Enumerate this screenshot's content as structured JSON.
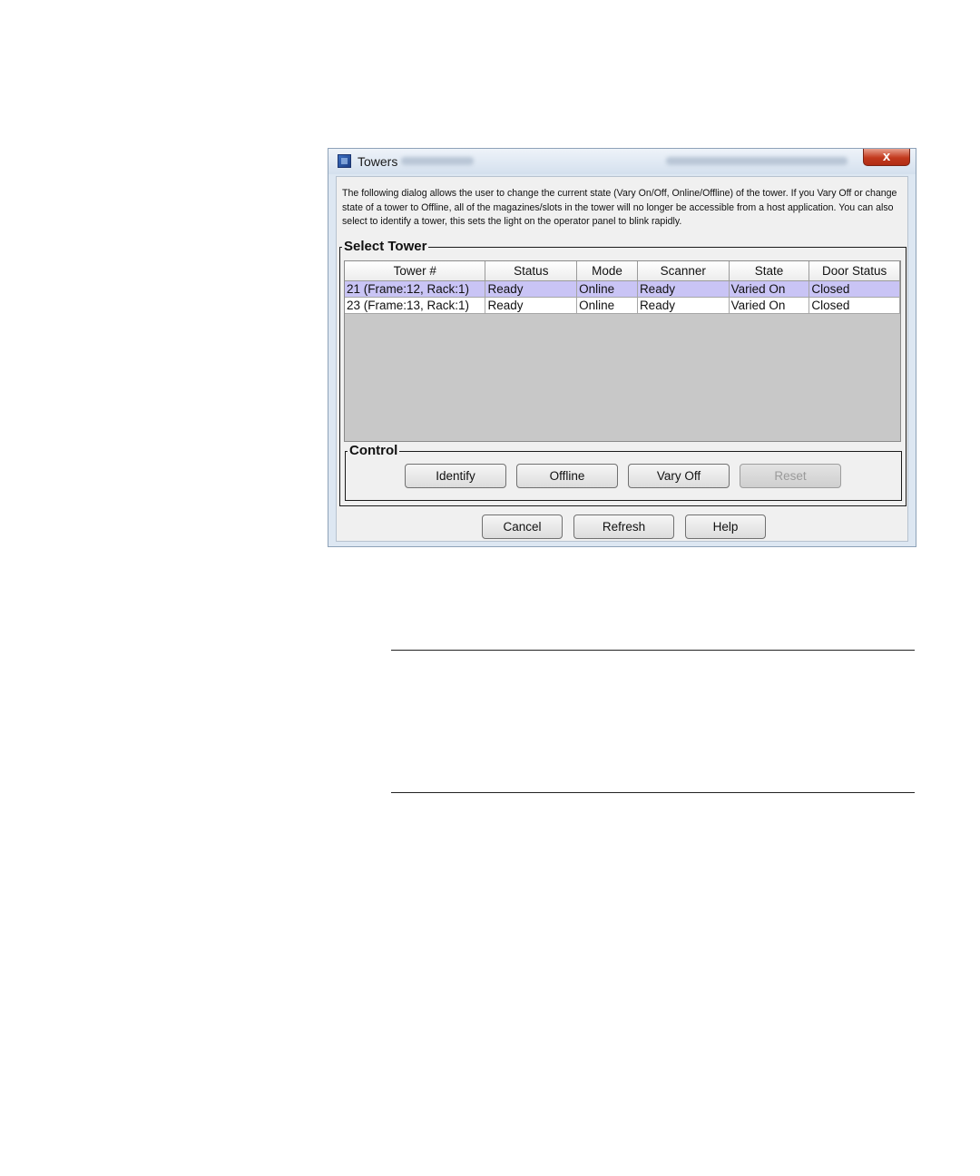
{
  "window": {
    "title": "Towers",
    "close_label": "x"
  },
  "description": "The following dialog allows the user to change the current state (Vary On/Off, Online/Offline) of the tower. If you Vary Off or change state of a tower to Offline, all of the magazines/slots in the tower will no longer be accessible from a host application. You can also select to identify a tower, this sets the light on the operator panel to blink rapidly.",
  "select_tower": {
    "title": "Select Tower",
    "columns": [
      "Tower #",
      "Status",
      "Mode",
      "Scanner",
      "State",
      "Door Status"
    ],
    "rows": [
      [
        "21 (Frame:12, Rack:1)",
        "Ready",
        "Online",
        "Ready",
        "Varied On",
        "Closed"
      ],
      [
        "23 (Frame:13, Rack:1)",
        "Ready",
        "Online",
        "Ready",
        "Varied On",
        "Closed"
      ]
    ],
    "selected_row": 0
  },
  "control": {
    "title": "Control",
    "identify_label": "Identify",
    "offline_label": "Offline",
    "vary_off_label": "Vary Off",
    "reset_label": "Reset"
  },
  "footer": {
    "cancel_label": "Cancel",
    "refresh_label": "Refresh",
    "help_label": "Help"
  },
  "colors": {
    "selection": "#c9c4f5",
    "close_button": "#c2391d",
    "window_frame": "#dde7f2"
  }
}
